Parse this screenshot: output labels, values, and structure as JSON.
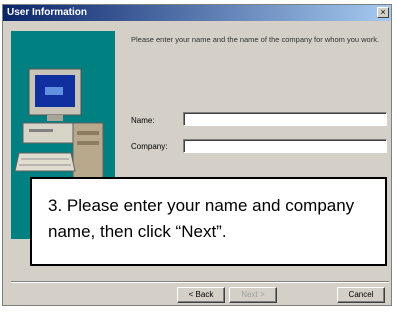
{
  "window": {
    "title": "User Information",
    "close_label": "×"
  },
  "prompt": "Please enter your name and the name of the company for whom you work.",
  "form": {
    "name_label": "Name:",
    "name_value": "",
    "company_label": "Company:",
    "company_value": ""
  },
  "buttons": {
    "back_label": "< Back",
    "next_label": "Next >",
    "cancel_label": "Cancel"
  },
  "callout": "3. Please enter your name and company name, then click “Next”.",
  "colors": {
    "title_bar": "#0a246a",
    "dialog_bg": "#d4d0c8",
    "art_bg": "#008080"
  },
  "icons": [
    "computer-illustration-icon",
    "close-icon"
  ]
}
